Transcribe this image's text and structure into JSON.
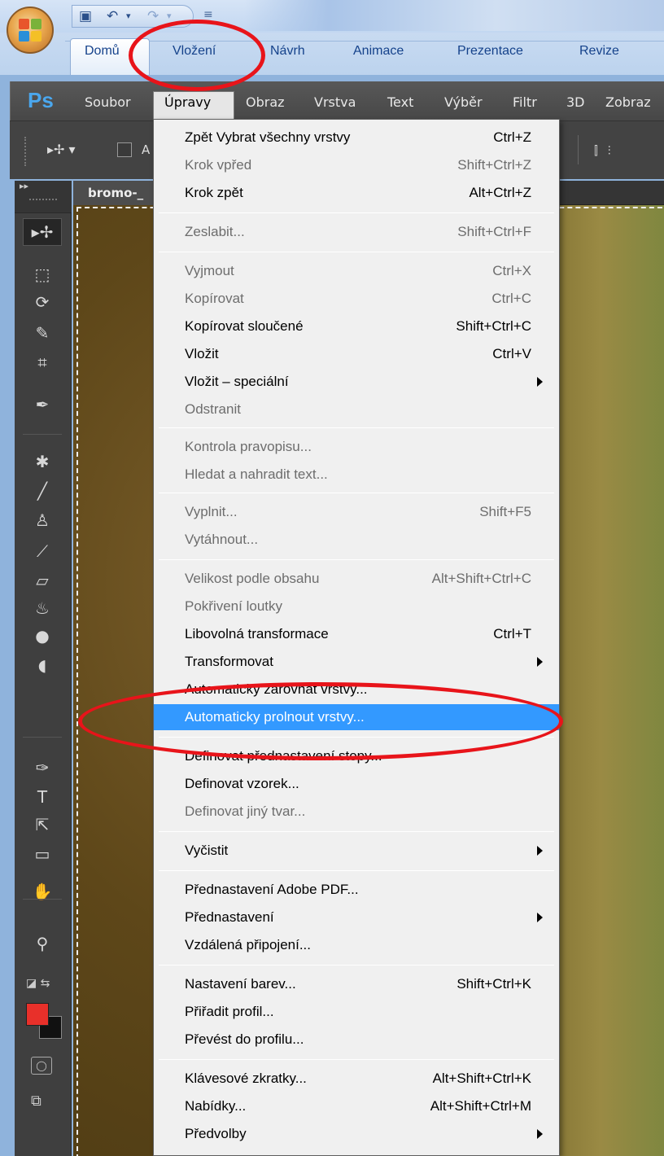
{
  "office": {
    "tabs": [
      "Domů",
      "Vložení",
      "Návrh",
      "Animace",
      "Prezentace",
      "Revize"
    ],
    "orb_colors": [
      "#e8552c",
      "#7ab23a",
      "#2a8fd8",
      "#f4c026"
    ]
  },
  "photoshop": {
    "logo": "Ps",
    "menus": [
      "Soubor",
      "Úpravy",
      "Obraz",
      "Vrstva",
      "Text",
      "Výběr",
      "Filtr",
      "3D",
      "Zobraz"
    ],
    "options_bar": {
      "auto_label": "A"
    },
    "document_tab": "bromo-_",
    "colors": {
      "foreground": "#e8302a",
      "background": "#111111",
      "highlight": "#3399ff",
      "annotation": "#e8141a"
    },
    "tools": [
      {
        "name": "move-tool-icon",
        "glyph": "▸✢"
      },
      {
        "name": "marquee-tool-icon",
        "glyph": "⬚"
      },
      {
        "name": "lasso-tool-icon",
        "glyph": "⟳"
      },
      {
        "name": "quick-selection-tool-icon",
        "glyph": "✎"
      },
      {
        "name": "crop-tool-icon",
        "glyph": "⌗"
      },
      {
        "name": "eyedropper-tool-icon",
        "glyph": "✒"
      },
      {
        "name": "healing-brush-tool-icon",
        "glyph": "✱"
      },
      {
        "name": "brush-tool-icon",
        "glyph": "╱"
      },
      {
        "name": "clone-stamp-tool-icon",
        "glyph": "♙"
      },
      {
        "name": "history-brush-tool-icon",
        "glyph": "⟋"
      },
      {
        "name": "eraser-tool-icon",
        "glyph": "▱"
      },
      {
        "name": "paint-bucket-tool-icon",
        "glyph": "♨"
      },
      {
        "name": "blur-tool-icon",
        "glyph": "●"
      },
      {
        "name": "dodge-tool-icon",
        "glyph": "◖"
      },
      {
        "name": "pen-tool-icon",
        "glyph": "✑"
      },
      {
        "name": "type-tool-icon",
        "glyph": "T"
      },
      {
        "name": "path-selection-tool-icon",
        "glyph": "⇱"
      },
      {
        "name": "rectangle-tool-icon",
        "glyph": "▭"
      },
      {
        "name": "hand-tool-icon",
        "glyph": "✋"
      },
      {
        "name": "zoom-tool-icon",
        "glyph": "⚲"
      }
    ]
  },
  "menu": {
    "items": [
      {
        "label": "Zpět Vybrat všechny vrstvy",
        "shortcut": "Ctrl+Z",
        "enabled": true
      },
      {
        "label": "Krok vpřed",
        "shortcut": "Shift+Ctrl+Z",
        "enabled": false
      },
      {
        "label": "Krok zpět",
        "shortcut": "Alt+Ctrl+Z",
        "enabled": true
      },
      {
        "label": "Zeslabit...",
        "shortcut": "Shift+Ctrl+F",
        "enabled": false
      },
      {
        "label": "Vyjmout",
        "shortcut": "Ctrl+X",
        "enabled": false
      },
      {
        "label": "Kopírovat",
        "shortcut": "Ctrl+C",
        "enabled": false
      },
      {
        "label": "Kopírovat sloučené",
        "shortcut": "Shift+Ctrl+C",
        "enabled": true
      },
      {
        "label": "Vložit",
        "shortcut": "Ctrl+V",
        "enabled": true
      },
      {
        "label": "Vložit – speciální",
        "shortcut": "",
        "enabled": true,
        "submenu": true
      },
      {
        "label": "Odstranit",
        "shortcut": "",
        "enabled": false
      },
      {
        "label": "Kontrola pravopisu...",
        "shortcut": "",
        "enabled": false
      },
      {
        "label": "Hledat a nahradit text...",
        "shortcut": "",
        "enabled": false
      },
      {
        "label": "Vyplnit...",
        "shortcut": "Shift+F5",
        "enabled": false
      },
      {
        "label": "Vytáhnout...",
        "shortcut": "",
        "enabled": false
      },
      {
        "label": "Velikost podle obsahu",
        "shortcut": "Alt+Shift+Ctrl+C",
        "enabled": false
      },
      {
        "label": "Pokřivení loutky",
        "shortcut": "",
        "enabled": false
      },
      {
        "label": "Libovolná transformace",
        "shortcut": "Ctrl+T",
        "enabled": true
      },
      {
        "label": "Transformovat",
        "shortcut": "",
        "enabled": true,
        "submenu": true
      },
      {
        "label": "Automaticky zarovnat vrstvy...",
        "shortcut": "",
        "enabled": true
      },
      {
        "label": "Automaticky prolnout vrstvy...",
        "shortcut": "",
        "enabled": true,
        "highlighted": true
      },
      {
        "label": "Definovat přednastavení stopy...",
        "shortcut": "",
        "enabled": true
      },
      {
        "label": "Definovat vzorek...",
        "shortcut": "",
        "enabled": true
      },
      {
        "label": "Definovat jiný tvar...",
        "shortcut": "",
        "enabled": false
      },
      {
        "label": "Vyčistit",
        "shortcut": "",
        "enabled": true,
        "submenu": true
      },
      {
        "label": "Přednastavení Adobe PDF...",
        "shortcut": "",
        "enabled": true
      },
      {
        "label": "Přednastavení",
        "shortcut": "",
        "enabled": true,
        "submenu": true
      },
      {
        "label": "Vzdálená připojení...",
        "shortcut": "",
        "enabled": true
      },
      {
        "label": "Nastavení barev...",
        "shortcut": "Shift+Ctrl+K",
        "enabled": true
      },
      {
        "label": "Přiřadit profil...",
        "shortcut": "",
        "enabled": true
      },
      {
        "label": "Převést do profilu...",
        "shortcut": "",
        "enabled": true
      },
      {
        "label": "Klávesové zkratky...",
        "shortcut": "Alt+Shift+Ctrl+K",
        "enabled": true
      },
      {
        "label": "Nabídky...",
        "shortcut": "Alt+Shift+Ctrl+M",
        "enabled": true
      },
      {
        "label": "Předvolby",
        "shortcut": "",
        "enabled": true,
        "submenu": true
      }
    ]
  }
}
